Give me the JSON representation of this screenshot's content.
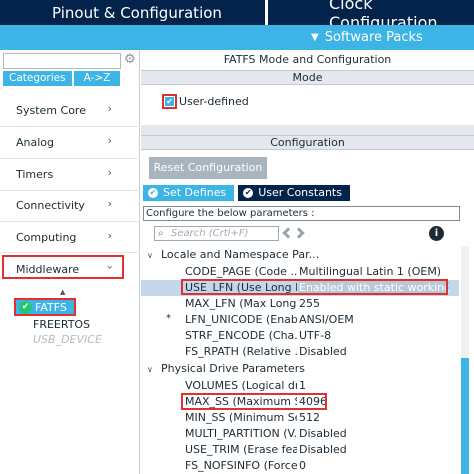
{
  "header": {
    "tab_pinout": "Pinout & Configuration",
    "tab_clock": "Clock Configuration",
    "software_packs": "Software Packs"
  },
  "left": {
    "category_tabs": [
      "Categories",
      "A->Z"
    ],
    "categories": [
      "System Core",
      "Analog",
      "Timers",
      "Connectivity",
      "Computing",
      "Middleware"
    ],
    "middleware_items": [
      {
        "label": "FATFS",
        "state": "enabled-selected"
      },
      {
        "label": "FREERTOS",
        "state": "normal"
      },
      {
        "label": "USB_DEVICE",
        "state": "disabled"
      }
    ]
  },
  "panel": {
    "title": "FATFS Mode and Configuration",
    "mode_header": "Mode",
    "user_defined_label": "User-defined",
    "user_defined_checked": true,
    "configuration_header": "Configuration",
    "reset_button": "Reset Configuration",
    "subtabs": [
      "Set Defines",
      "User Constants"
    ],
    "configure_text": "Configure the below parameters :",
    "search_placeholder": "Search (Crtl+F)",
    "groups": [
      {
        "label": "Locale and Namespace Par...",
        "params": [
          {
            "star": false,
            "name": "CODE_PAGE (Code ...",
            "value": "Multilingual Latin 1 (OEM)"
          },
          {
            "star": false,
            "name": "USE_LFN (Use Long F...",
            "value": "Enabled with static working buff",
            "selected": true
          },
          {
            "star": false,
            "name": "MAX_LFN (Max Long ...",
            "value": "255"
          },
          {
            "star": true,
            "name": "LFN_UNICODE (Enabl...",
            "value": "ANSI/OEM"
          },
          {
            "star": false,
            "name": "STRF_ENCODE (Cha...",
            "value": "UTF-8"
          },
          {
            "star": false,
            "name": "FS_RPATH (Relative ...",
            "value": "Disabled"
          }
        ]
      },
      {
        "label": "Physical Drive Parameters",
        "params": [
          {
            "star": false,
            "name": "VOLUMES (Logical dri...",
            "value": "1"
          },
          {
            "star": false,
            "name": "MAX_SS (Maximum S...",
            "value": "4096"
          },
          {
            "star": false,
            "name": "MIN_SS (Minimum Sec...",
            "value": "512"
          },
          {
            "star": false,
            "name": "MULTI_PARTITION (V...",
            "value": "Disabled"
          },
          {
            "star": false,
            "name": "USE_TRIM (Erase feat...",
            "value": "Disabled"
          },
          {
            "star": false,
            "name": "FS_NOFSINFO (Force...",
            "value": "0"
          }
        ]
      }
    ]
  },
  "colors": {
    "navy": "#03234b",
    "accent": "#3cb4e6",
    "highlight_border": "#e0302f",
    "ok_green": "#1ec873"
  },
  "icons": [
    "chevron-right-icon",
    "chevron-down-icon",
    "checkmark-icon",
    "search-icon",
    "info-icon",
    "expand-icon",
    "collapse-icon",
    "gear-icon"
  ]
}
